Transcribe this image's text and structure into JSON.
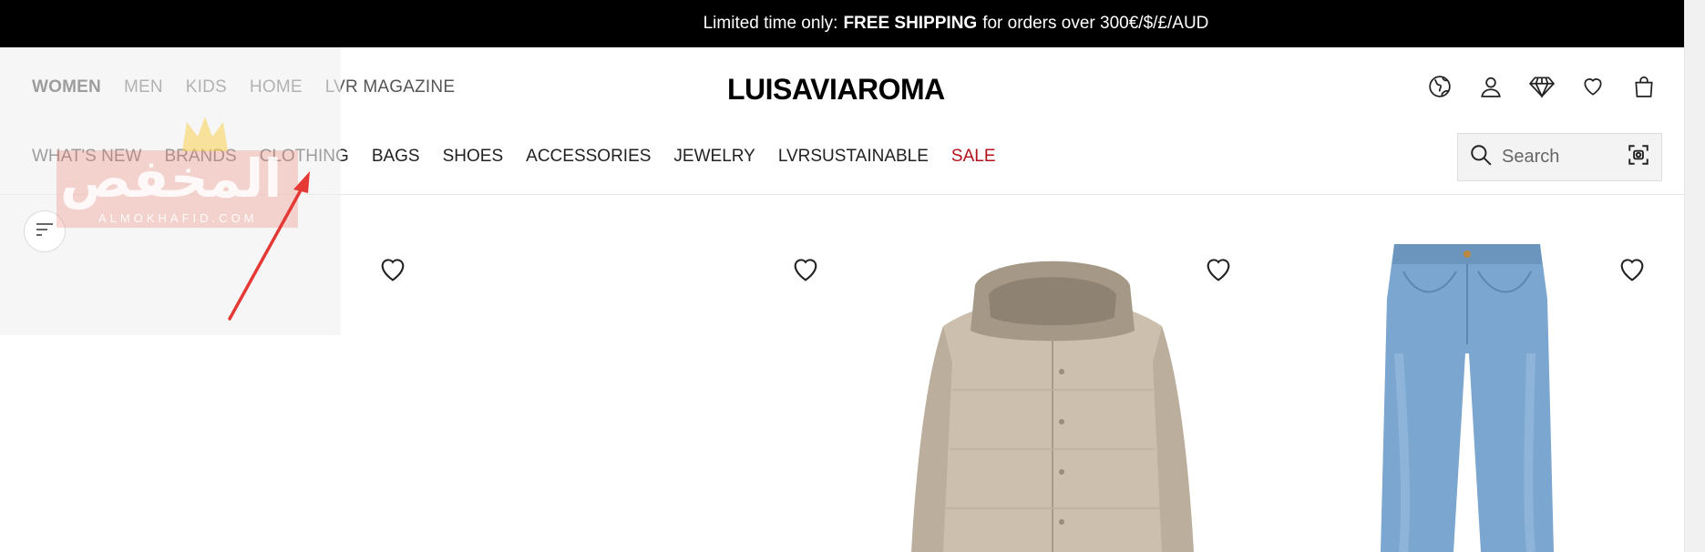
{
  "promo": {
    "lead": "Limited time only:",
    "highlight": "FREE SHIPPING",
    "tail": "for orders over 300€/$/£/AUD"
  },
  "gender_nav": [
    "WOMEN",
    "MEN",
    "KIDS",
    "HOME",
    "LVR MAGAZINE"
  ],
  "logo": "LUISAVIAROMA",
  "utility_icons": [
    "globe-icon",
    "user-icon",
    "diamond-icon",
    "heart-icon",
    "bag-icon"
  ],
  "category_nav": [
    "WHAT'S NEW",
    "BRANDS",
    "CLOTHING",
    "BAGS",
    "SHOES",
    "ACCESSORIES",
    "JEWELRY",
    "LVRSUSTAINABLE",
    "SALE"
  ],
  "search": {
    "placeholder": "Search"
  },
  "watermark": {
    "text": "المخفص",
    "sub": "ALMOKHAFID.COM"
  },
  "colors": {
    "sale": "#b4121c",
    "promo_bg": "#000000",
    "accent_arrow": "#e53935"
  }
}
